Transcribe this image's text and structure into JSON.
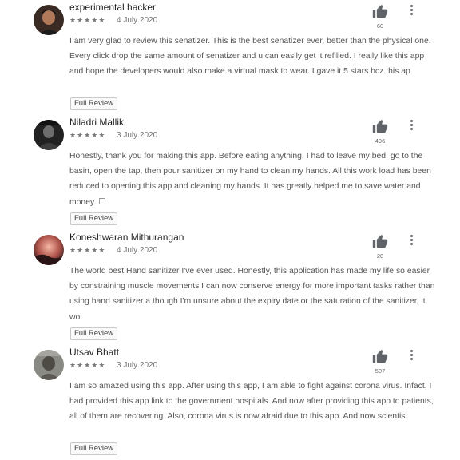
{
  "reviews": [
    {
      "name": "experimental hacker",
      "stars": "★★★★★",
      "date": "4 July 2020",
      "text": "I am very glad to review this senatizer. This is the best senatizer ever, better than the physical one. Every click drop the same amount of senatizer and u can easily get it refilled. I really like this app and hope the developers would also make a virtual mask to wear. I gave it 5 stars bcz this ap",
      "likes": "60",
      "button": "Full Review"
    },
    {
      "name": "Niladri Mallik",
      "stars": "★★★★★",
      "date": "3 July 2020",
      "text": "Honestly, thank you for making this app. Before eating anything, I had to leave my bed, go to the basin, open the tap, then pour sanitizer on my hand to clean my hands. All this work load has been reduced to opening this app and cleaning my hands. It has greatly helped me to save water and money. ☐",
      "likes": "496",
      "button": "Full Review"
    },
    {
      "name": "Koneshwaran Mithurangan",
      "stars": "★★★★★",
      "date": "4 July 2020",
      "text": "The world best Hand sanitizer I've ever used. Honestly, this application has made my life so easier by constraining muscle movements I can now conserve energy for more important tasks rather than using hand sanitizer a though I'm unsure about the expiry date or the saturation of the sanitizer, it wo",
      "likes": "28",
      "button": "Full Review"
    },
    {
      "name": "Utsav Bhatt",
      "stars": "★★★★★",
      "date": "3 July 2020",
      "text": "I am so amazed using this app. After using this app, I am able to fight against corona virus. Infact, I had provided this app link to the government hospitals. And now after providing this app to patients, all of them are recovering. Also, corona virus is now afraid due to this app. And now scientis",
      "likes": "507",
      "button": "Full Review"
    }
  ],
  "icons": {
    "like": "thumbs-up-icon",
    "menu": "more-vert-icon"
  },
  "colors": {
    "icon": "#5f6368",
    "star": "#7a7a7a"
  }
}
